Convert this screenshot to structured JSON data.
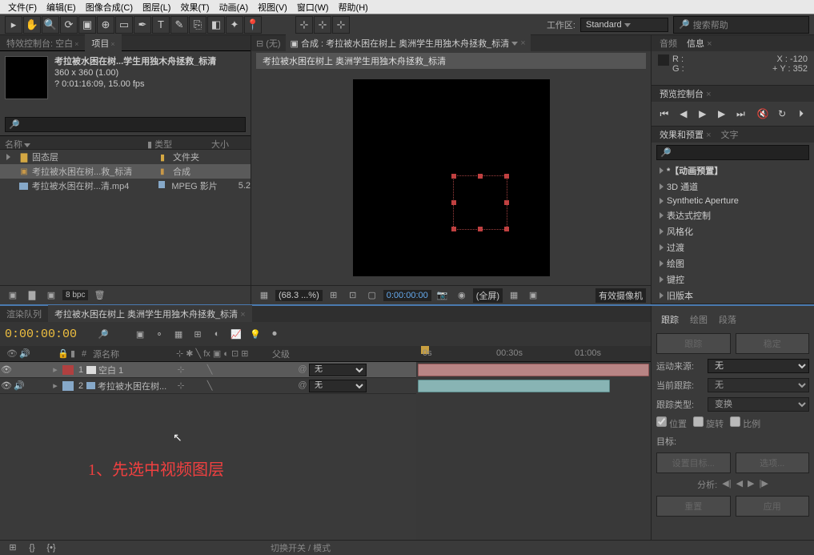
{
  "menu": {
    "file": "文件(F)",
    "edit": "编辑(E)",
    "composition": "图像合成(C)",
    "layer": "图层(L)",
    "effect": "效果(T)",
    "animation": "动画(A)",
    "view": "视图(V)",
    "window": "窗口(W)",
    "help": "帮助(H)"
  },
  "toolbar": {
    "workspace_label": "工作区:",
    "workspace_value": "Standard",
    "search_help": "搜索帮助"
  },
  "left_tabs": {
    "efx_control": "特效控制台: 空白",
    "project": "项目"
  },
  "comp_info": {
    "name": "考拉被水困在树...学生用独木舟拯救_标清",
    "dims": "360 x 360 (1.00)",
    "dur": "? 0:01:16:09, 15.00 fps"
  },
  "project_cols": {
    "name": "名称",
    "type": "类型",
    "size": "大小"
  },
  "project_items": [
    {
      "name": "固态层",
      "type": "文件夹",
      "size": "",
      "kind": "folder"
    },
    {
      "name": "考拉被水困在树...救_标清",
      "type": "合成",
      "size": "",
      "kind": "comp"
    },
    {
      "name": "考拉被水困在树...清.mp4",
      "type": "MPEG 影片",
      "size": "5.2",
      "kind": "movie"
    }
  ],
  "bpc": "8 bpc",
  "viewer": {
    "none_tab": "(无)",
    "comp_tab_prefix": "合成 :",
    "comp_name": "考拉被水困在树上 奥洲学生用独木舟拯救_标清",
    "zoom": "(68.3 ...%)",
    "time": "0:00:00:00",
    "full": "(全屏)",
    "camera": "有效摄像机"
  },
  "right": {
    "audio_tab": "音频",
    "info_tab": "信息",
    "info": {
      "r": "R :",
      "g": "G :",
      "x": "X : -120",
      "y": "Y : 352",
      "xsym": "+"
    },
    "preview_tab": "预览控制台",
    "efx_tab": "效果和预置",
    "text_tab": "文字",
    "efx_items": [
      "*【动画预置】",
      "3D 通道",
      "Synthetic Aperture",
      "表达式控制",
      "风格化",
      "过渡",
      "绘图",
      "键控",
      "旧版本"
    ]
  },
  "timeline": {
    "render_tab": "渲染队列",
    "comp_tab": "考拉被水困在树上 奥洲学生用独木舟拯救_标清",
    "timecode": "0:00:00:00",
    "src_name_hdr": "源名称",
    "parent_hdr": "父级",
    "ruler": {
      "t1": "0s",
      "t2": "00:30s",
      "t3": "01:00s"
    },
    "layers": [
      {
        "num": "1",
        "name": "空白 1",
        "color": "#b04040",
        "mode": "无",
        "selected": true,
        "kind": "solid"
      },
      {
        "num": "2",
        "name": "考拉被水困在树...",
        "color": "#86a8c8",
        "mode": "无",
        "selected": false,
        "kind": "movie"
      }
    ],
    "none_option": "无",
    "switches_label": "切换开关 / 模式"
  },
  "annotation": "1、先选中视频图层",
  "tracker": {
    "tab1": "跟踪",
    "tab2": "绘图",
    "tab3": "段落",
    "track_btn": "跟踪",
    "stabilize_btn": "稳定",
    "motion_src": "运动来源:",
    "motion_src_val": "无",
    "cur_track": "当前跟踪:",
    "cur_track_val": "无",
    "track_type": "跟踪类型:",
    "track_type_val": "变换",
    "pos": "位置",
    "rot": "旋转",
    "scale": "比例",
    "target": "目标:",
    "set_target": "设置目标...",
    "options": "选项...",
    "analyze": "分析:",
    "reset": "重置",
    "apply": "应用"
  }
}
